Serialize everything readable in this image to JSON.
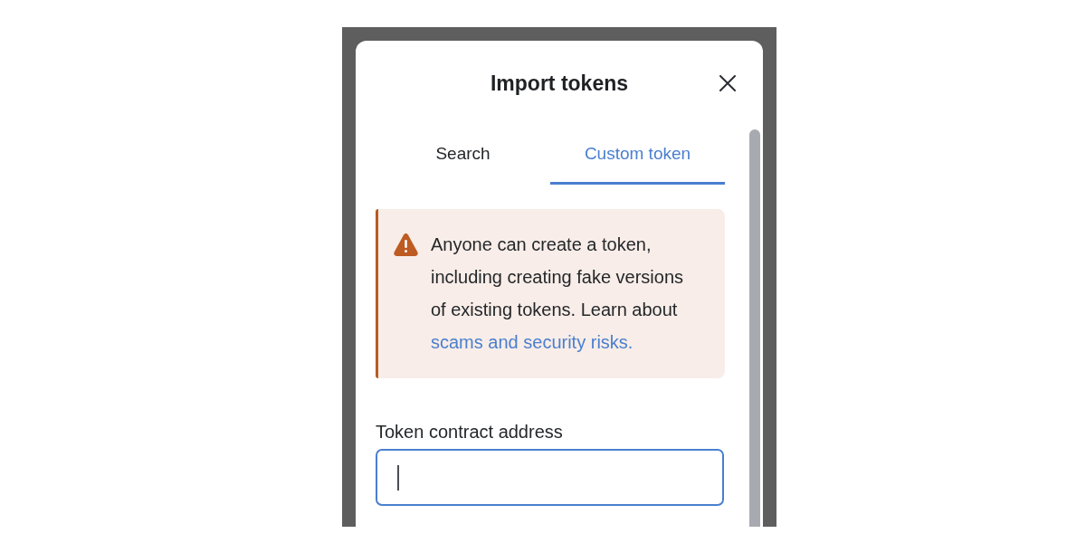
{
  "dialog": {
    "title": "Import tokens"
  },
  "tabs": [
    {
      "label": "Search",
      "selected": false
    },
    {
      "label": "Custom token",
      "selected": true
    }
  ],
  "alert": {
    "kind": "warning",
    "text": "Anyone can create a token, including creating fake versions of existing tokens. Learn about",
    "link": "scams and security risks."
  },
  "field": {
    "label": "Token contract address",
    "focused": true
  }
}
